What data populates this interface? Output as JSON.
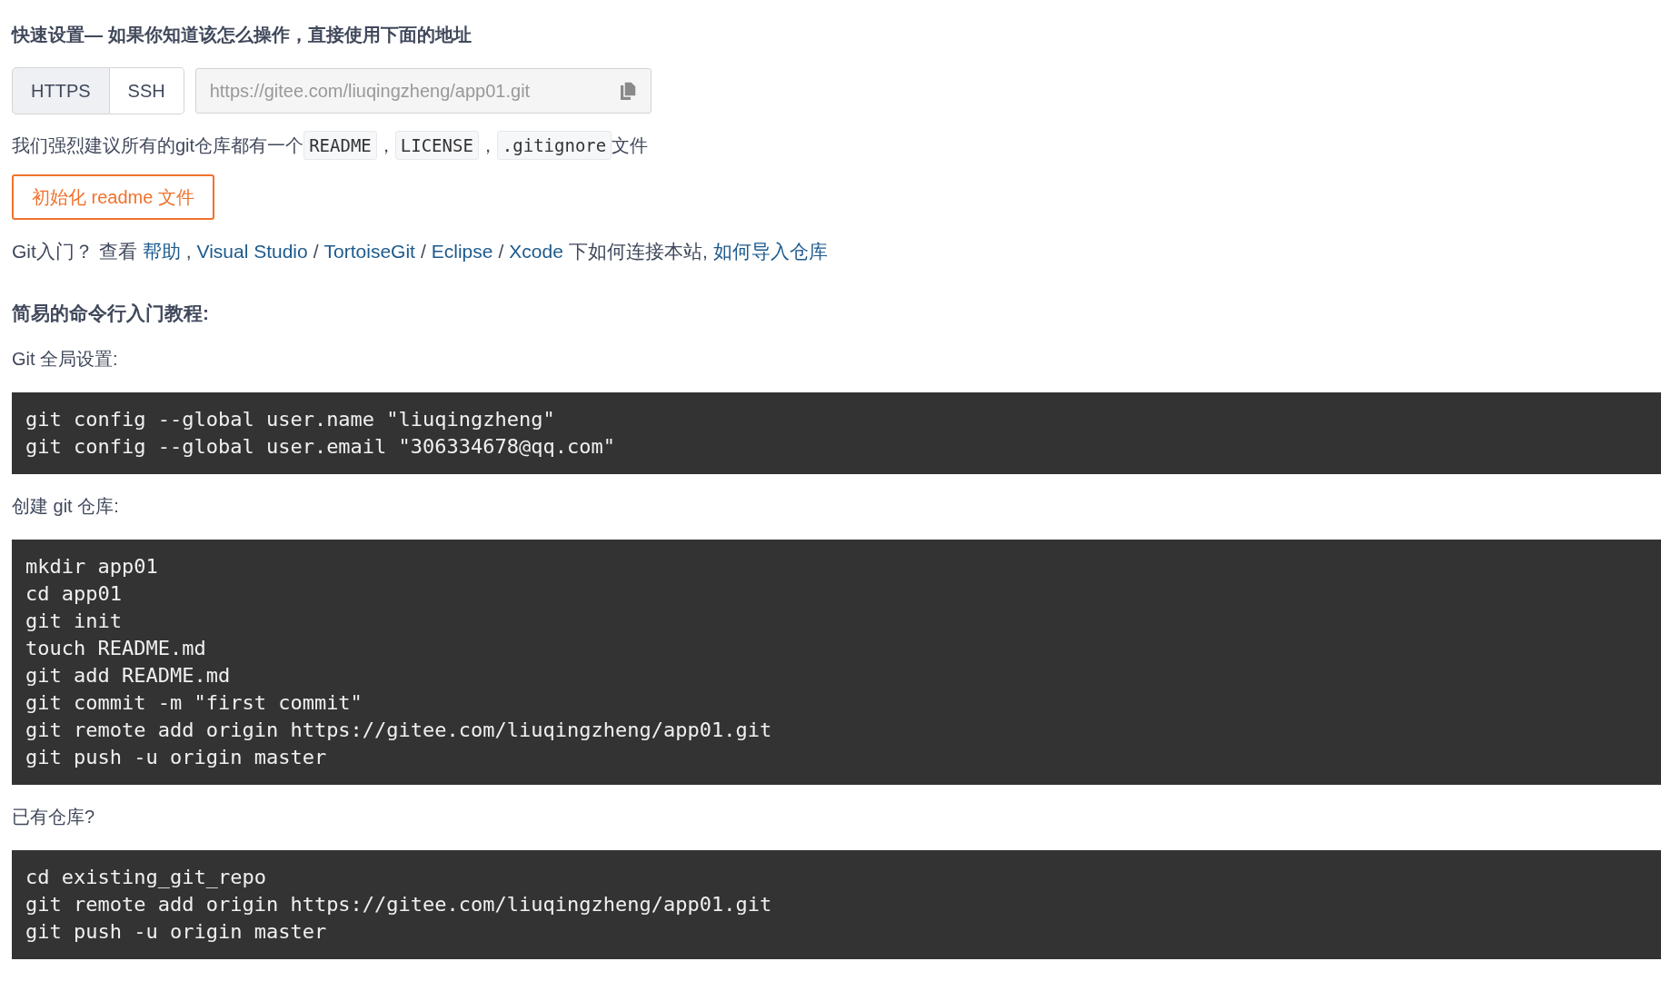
{
  "heading": "快速设置— 如果你知道该怎么操作，直接使用下面的地址",
  "protocol_tabs": [
    {
      "label": "HTTPS",
      "selected": true
    },
    {
      "label": "SSH",
      "selected": false
    }
  ],
  "clone_url": {
    "value": "https://gitee.com/liuqingzheng/app01.git"
  },
  "recommend": [
    {
      "kind": "text",
      "text": "我们强烈建议所有的git仓库都有一个"
    },
    {
      "kind": "code",
      "text": "README"
    },
    {
      "kind": "text",
      "text": "，"
    },
    {
      "kind": "code",
      "text": "LICENSE"
    },
    {
      "kind": "text",
      "text": "，"
    },
    {
      "kind": "code",
      "text": ".gitignore"
    },
    {
      "kind": "text",
      "text": "文件"
    }
  ],
  "init_button": "初始化 readme 文件",
  "help_line": [
    {
      "kind": "text",
      "text": "Git入门？ 查看"
    },
    {
      "kind": "link",
      "text": "帮助"
    },
    {
      "kind": "text",
      "text": ","
    },
    {
      "kind": "link",
      "text": "Visual Studio"
    },
    {
      "kind": "text",
      "text": "/"
    },
    {
      "kind": "link",
      "text": "TortoiseGit"
    },
    {
      "kind": "text",
      "text": "/"
    },
    {
      "kind": "link",
      "text": "Eclipse"
    },
    {
      "kind": "text",
      "text": "/"
    },
    {
      "kind": "link",
      "text": "Xcode"
    },
    {
      "kind": "text",
      "text": "下如何连接本站,"
    },
    {
      "kind": "link",
      "text": "如何导入仓库"
    }
  ],
  "tutorial_title": "简易的命令行入门教程:",
  "sections": [
    {
      "label": "Git 全局设置:",
      "lines": [
        "git config --global user.name \"liuqingzheng\"",
        "git config --global user.email \"306334678@qq.com\""
      ]
    },
    {
      "label": "创建 git 仓库:",
      "lines": [
        "mkdir app01",
        "cd app01",
        "git init",
        "touch README.md",
        "git add README.md",
        "git commit -m \"first commit\"",
        "git remote add origin https://gitee.com/liuqingzheng/app01.git",
        "git push -u origin master"
      ]
    },
    {
      "label": "已有仓库?",
      "lines": [
        "cd existing_git_repo",
        "git remote add origin https://gitee.com/liuqingzheng/app01.git",
        "git push -u origin master"
      ]
    }
  ]
}
